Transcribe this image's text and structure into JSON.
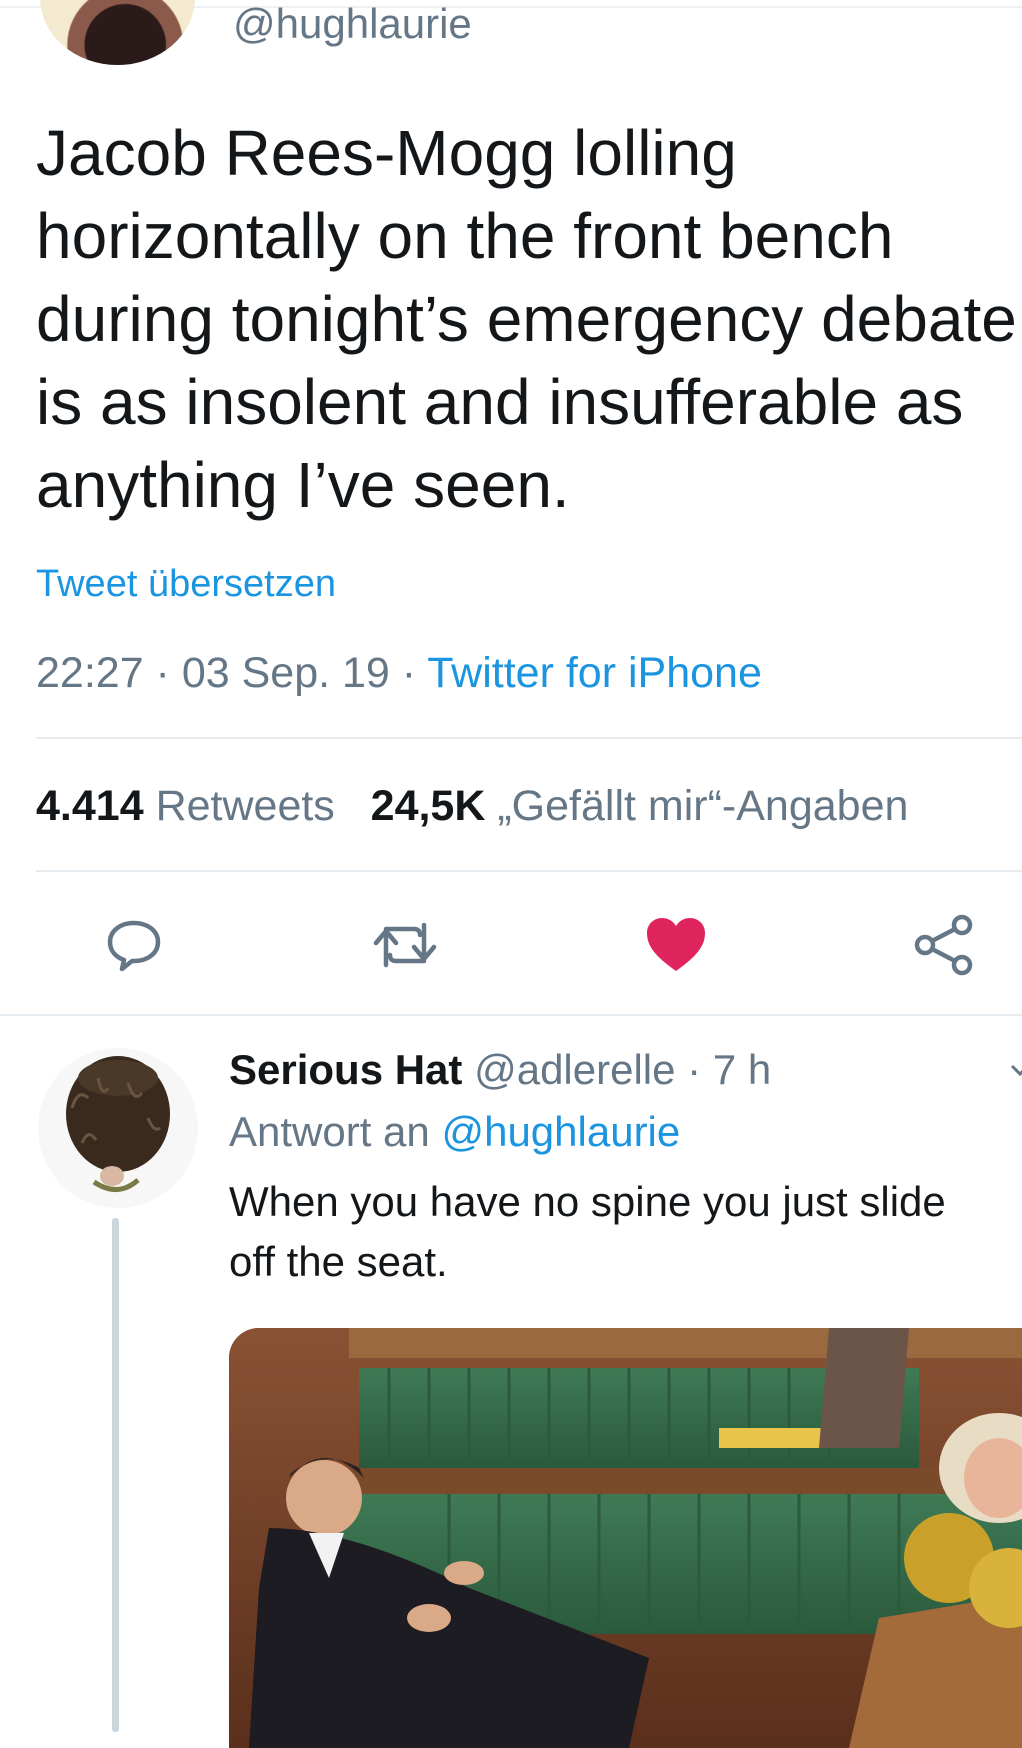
{
  "original_tweet": {
    "handle": "@hughlaurie",
    "text_lines": [
      "Jacob Rees-Mogg lolling",
      "horizontally on the front bench",
      "during tonight’s emergency debate",
      "is as insolent and insufferable as",
      "anything I’ve seen."
    ],
    "translate_label": "Tweet übersetzen",
    "time": "22:27",
    "separator": " · ",
    "date": "03 Sep. 19",
    "source": "Twitter for iPhone",
    "retweets_count": "4.414",
    "retweets_label": "Retweets",
    "likes_count": "24,5K",
    "likes_label": "„Gefällt mir“-Angaben"
  },
  "actions": {
    "reply_icon": "reply-icon",
    "retweet_icon": "retweet-icon",
    "like_icon": "heart-icon",
    "share_icon": "share-icon",
    "like_color": "#e0245e"
  },
  "reply": {
    "name": "Serious Hat",
    "handle": "@adlerelle",
    "separator": " · ",
    "time": "7 h",
    "reply_prefix": "Antwort an",
    "reply_to": "@hughlaurie",
    "text_lines": [
      "When you have no spine you just slide",
      "off the seat."
    ]
  },
  "colors": {
    "link": "#1b95e0",
    "secondary_text": "#657786",
    "primary_text": "#14171a",
    "divider": "#e6ecf0"
  }
}
